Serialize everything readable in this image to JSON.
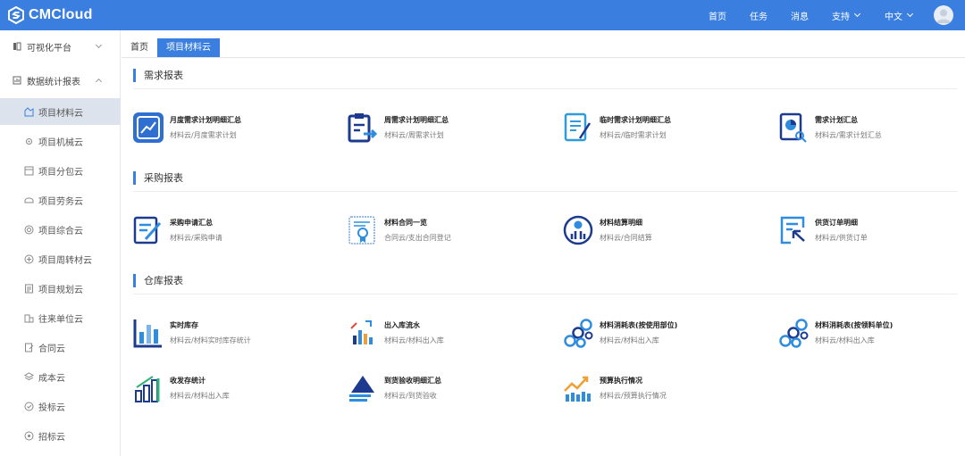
{
  "header": {
    "logo_text": "CMCloud",
    "nav": [
      "首页",
      "任务",
      "消息",
      "支持",
      "中文"
    ],
    "brand_color": "#3a7fe0"
  },
  "sidebar": {
    "groups": [
      "可视化平台",
      "数据统计报表"
    ],
    "items": [
      "项目材料云",
      "项目机械云",
      "项目分包云",
      "项目劳务云",
      "项目综合云",
      "项目周转材云",
      "项目规划云",
      "往来单位云",
      "合同云",
      "成本云",
      "投标云",
      "招标云"
    ]
  },
  "tabs": [
    "首页",
    "项目材料云"
  ],
  "sections": [
    {
      "title": "需求报表",
      "cards": [
        {
          "title": "月度需求计划明细汇总",
          "sub": "材料云/月度需求计划",
          "icon": "monthly-chart-icon"
        },
        {
          "title": "周需求计划明细汇总",
          "sub": "材料云/周需求计划",
          "icon": "weekly-clipboard-icon"
        },
        {
          "title": "临时需求计划明细汇总",
          "sub": "材料云/临时需求计划",
          "icon": "temp-document-icon"
        },
        {
          "title": "需求计划汇总",
          "sub": "材料云/需求计划汇总",
          "icon": "report-search-icon"
        }
      ]
    },
    {
      "title": "采购报表",
      "cards": [
        {
          "title": "采购申请汇总",
          "sub": "材料云/采购申请",
          "icon": "purchase-request-icon"
        },
        {
          "title": "材料合同一览",
          "sub": "合同云/支出合同登记",
          "icon": "contract-certificate-icon"
        },
        {
          "title": "材料结算明细",
          "sub": "材料云/合同结算",
          "icon": "settlement-coin-icon"
        },
        {
          "title": "供货订单明细",
          "sub": "材料云/供货订单",
          "icon": "supply-order-icon"
        }
      ]
    },
    {
      "title": "仓库报表",
      "cards": [
        {
          "title": "实时库存",
          "sub": "材料云/材料实时库存统计",
          "icon": "inventory-bars-icon"
        },
        {
          "title": "出入库流水",
          "sub": "材料云/材料出入库",
          "icon": "stock-flow-icon"
        },
        {
          "title": "材料消耗表(按使用部位)",
          "sub": "材料云/材料出入库",
          "icon": "pipes-consumption-icon"
        },
        {
          "title": "材料消耗表(按领料单位)",
          "sub": "材料云/材料出入库",
          "icon": "pipes-unit-icon"
        },
        {
          "title": "收发存统计",
          "sub": "材料云/材料出入库",
          "icon": "growth-bars-icon"
        },
        {
          "title": "到货验收明细汇总",
          "sub": "材料云/到货验收",
          "icon": "arrival-mountain-icon"
        },
        {
          "title": "预算执行情况",
          "sub": "材料云/预算执行情况",
          "icon": "budget-trend-icon"
        }
      ]
    }
  ]
}
